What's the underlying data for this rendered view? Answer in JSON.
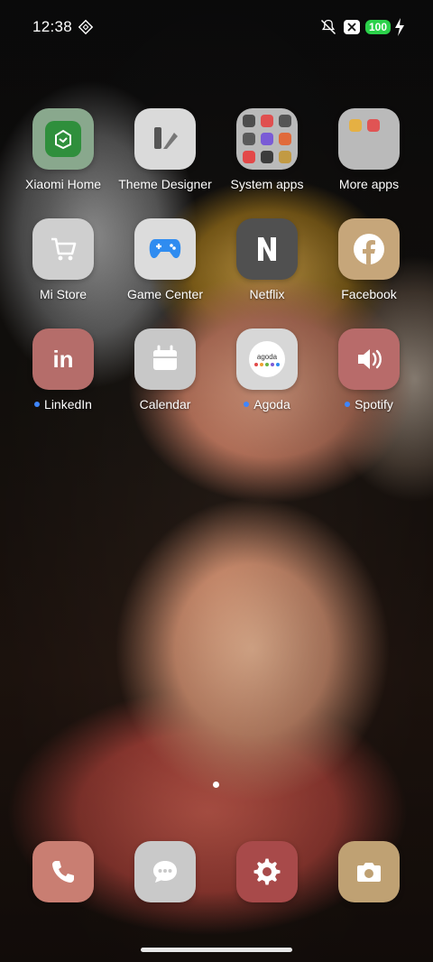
{
  "status": {
    "time": "12:38",
    "battery": "100",
    "icons": [
      "nfc-icon",
      "mute-vibrate-icon",
      "close-box-icon",
      "charging-bolt-icon"
    ]
  },
  "apps": [
    {
      "name": "xiaomi-home",
      "label": "Xiaomi Home",
      "icon": "xiaomi-home-icon",
      "bg": "#2f8f3c"
    },
    {
      "name": "theme-designer",
      "label": "Theme Designer",
      "icon": "theme-designer-icon",
      "bg": "#e9e9e9"
    },
    {
      "name": "system-apps-folder",
      "label": "System apps",
      "icon": "folder-icon",
      "bg": "#c9c9c9"
    },
    {
      "name": "more-apps-folder",
      "label": "More apps",
      "icon": "folder-icon",
      "bg": "#c9c9c9"
    },
    {
      "name": "mi-store",
      "label": "Mi Store",
      "icon": "cart-icon",
      "bg": "#cfcfcf"
    },
    {
      "name": "game-center",
      "label": "Game Center",
      "icon": "gamepad-icon",
      "bg": "#d9d9d9"
    },
    {
      "name": "netflix",
      "label": "Netflix",
      "icon": "netflix-n-icon",
      "bg": "#505050"
    },
    {
      "name": "facebook",
      "label": "Facebook",
      "icon": "facebook-icon",
      "bg": "#c6a67a"
    },
    {
      "name": "linkedin",
      "label": "LinkedIn",
      "icon": "linkedin-icon",
      "bg": "#b56d6a",
      "badge": true
    },
    {
      "name": "calendar",
      "label": "Calendar",
      "icon": "calendar-icon",
      "bg": "#c8c8c8"
    },
    {
      "name": "agoda",
      "label": "Agoda",
      "icon": "agoda-icon",
      "bg": "#d7d7d7",
      "badge": true
    },
    {
      "name": "spotify",
      "label": "Spotify",
      "icon": "speaker-icon",
      "bg": "#b86b6a",
      "badge": true
    }
  ],
  "folder_system_colors": [
    "#4d4d4d",
    "#e04f4f",
    "#555555",
    "#5a5a5a",
    "#7a5bd6",
    "#e06a3b",
    "#e34848",
    "#3c3c3c",
    "#c29a43"
  ],
  "folder_more_colors": [
    "#e5b043",
    "#e05454"
  ],
  "agoda_text": "agoda",
  "dock": [
    {
      "name": "phone",
      "icon": "phone-icon",
      "bg": "#c97e72"
    },
    {
      "name": "messages",
      "icon": "message-icon",
      "bg": "#c9c9c9"
    },
    {
      "name": "settings",
      "icon": "gear-icon",
      "bg": "#a84a4a"
    },
    {
      "name": "camera",
      "icon": "camera-icon",
      "bg": "#bfa173"
    }
  ],
  "colors": {
    "badge_dot": "#3f86ff",
    "battery_bg": "#2bd14a"
  }
}
